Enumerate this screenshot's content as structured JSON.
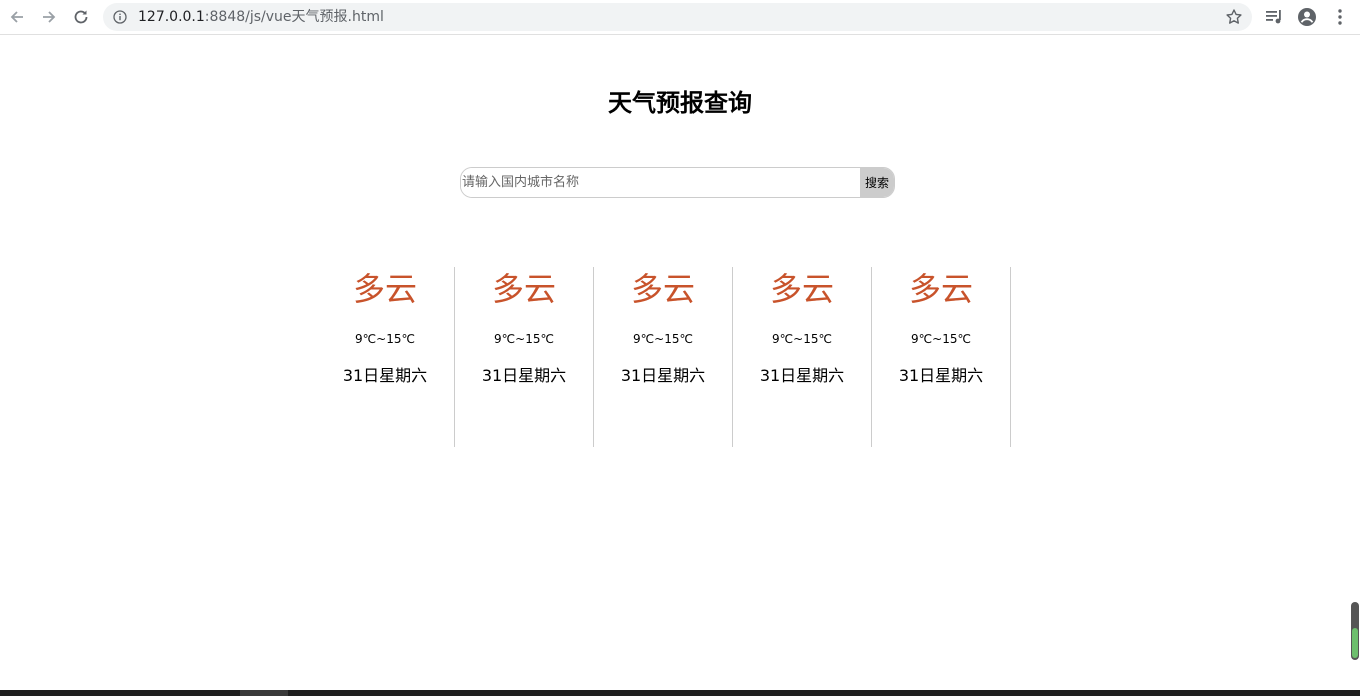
{
  "browser": {
    "url_host": "127.0.0.1",
    "url_rest": ":8848/js/vue天气预报.html"
  },
  "page": {
    "title": "天气预报查询"
  },
  "search": {
    "placeholder": "请输入国内城市名称",
    "value": "",
    "button_label": "搜索"
  },
  "forecast": [
    {
      "type": "多云",
      "temp": "9℃~15℃",
      "date": "31日星期六"
    },
    {
      "type": "多云",
      "temp": "9℃~15℃",
      "date": "31日星期六"
    },
    {
      "type": "多云",
      "temp": "9℃~15℃",
      "date": "31日星期六"
    },
    {
      "type": "多云",
      "temp": "9℃~15℃",
      "date": "31日星期六"
    },
    {
      "type": "多云",
      "temp": "9℃~15℃",
      "date": "31日星期六"
    }
  ],
  "colors": {
    "weather_type": "#c8532b",
    "divider": "#cccccc",
    "search_button_bg": "#cccccc"
  },
  "icons": {
    "back": "arrow-left-icon",
    "forward": "arrow-right-icon",
    "reload": "reload-icon",
    "info": "info-icon",
    "star": "star-icon",
    "media": "media-control-icon",
    "account": "account-icon",
    "menu": "kebab-menu-icon"
  }
}
